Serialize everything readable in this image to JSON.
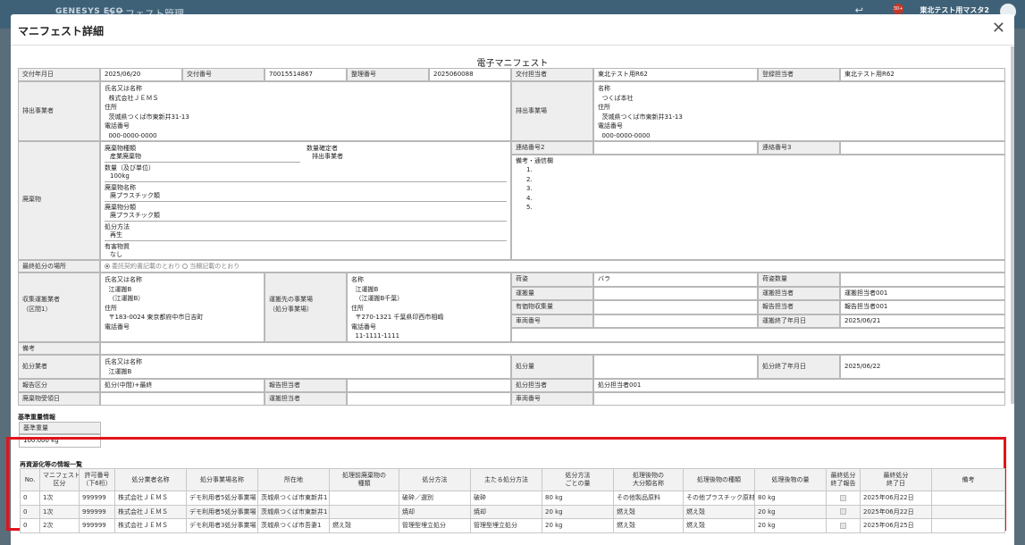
{
  "app": {
    "logo": "GENESYS ECO",
    "title": "マニフェスト管理",
    "user": "東北テスト用マスタ2",
    "badge": "30+"
  },
  "dialog": {
    "title": "マニフェスト詳細",
    "manifest_title": "電子マニフェスト"
  },
  "row1": {
    "l1": "交付年月日",
    "v1": "2025/06/20",
    "l2": "交付番号",
    "v2": "70015514867",
    "l3": "整理番号",
    "v3": "2025060088",
    "l4": "交付担当者",
    "v4": "東北テスト用R62",
    "l5": "登録担当者",
    "v5": "東北テスト用R62"
  },
  "discharger": {
    "label": "排出事業者",
    "text": "氏名又は名称\n  株式会社ＪＥＭＳ\n住所\n  茨城県つくば市東新井31-13\n電話番号\n  000-0000-0000"
  },
  "site": {
    "label": "排出事業場",
    "text": "名称\n  つくば本社\n住所\n  茨城県つくば市東新井31-13\n電話番号\n  000-0000-0000"
  },
  "waste": {
    "label": "廃棄物",
    "type_l": "廃棄物種類",
    "type_v": "産業廃棄物",
    "qty_l": "数量（及び単位）",
    "qty_v": "100kg",
    "name_l": "廃棄物名称",
    "name_v": "廃プラスチック類",
    "cls_l": "廃棄物分類",
    "cls_v": "廃プラスチック類",
    "method_l": "処分方法",
    "method_v": "再生",
    "haz_l": "有害物質",
    "haz_v": "なし",
    "conf_l": "数量確定者",
    "conf_v": "排出事業者"
  },
  "contact": {
    "l2": "連絡番号2",
    "l3": "連絡番号3",
    "remarks_l": "備考・通信欄",
    "remarks": "1.\n2.\n3.\n4.\n5."
  },
  "final": {
    "label": "最終処分の場所",
    "opt1": "委託契約書記載のとおり",
    "opt2": "当欄記載のとおり"
  },
  "transport": {
    "label": "収集運搬業者\n（区間1）",
    "text": "氏名又は名称\n  江運搬B\n  （江運搬B）\n住所\n  〒183-0024 東京都府中市日吉町\n電話番号",
    "dest_l": "運搬先の事業場\n（処分事業場）",
    "dest": "名称\n  江運搬B\n  （江運搬B千葉）\n住所\n  〒270-1321 千葉県印西市相嶋\n電話番号\n  11-1111-1111",
    "pkg_l": "荷姿",
    "pkg_v": "バラ",
    "pkgq_l": "荷姿数量",
    "qty_l": "運搬量",
    "rep_l": "運搬担当者",
    "rep_v": "運搬担当者001",
    "val_l": "有価物収集量",
    "rrep_l": "報告担当者",
    "rrep_v": "報告担当者001",
    "car_l": "車両番号",
    "end_l": "運搬終了年月日",
    "end_v": "2025/06/21"
  },
  "note": {
    "label": "備考"
  },
  "processor": {
    "label": "処分業者",
    "text": "氏名又は名称\n  江運搬B",
    "amt_l": "処分量",
    "end_l": "処分終了年月日",
    "end_v": "2025/06/22",
    "rtype_l": "報告区分",
    "rtype_v": "処分(中間)+最終",
    "rrep_l": "報告担当者",
    "prep_l": "処分担当者",
    "prep_v": "処分担当者001",
    "recv_l": "廃棄物受領日",
    "trep_l": "運搬担当者",
    "car_l": "車両番号"
  },
  "base": {
    "section": "基準重量情報",
    "label": "基準重量",
    "value": "100.000 kg"
  },
  "recycle": {
    "section": "再資源化等の情報一覧",
    "headers": [
      "No.",
      "マニフェスト\n区分",
      "許可番号\n（下6桁）",
      "処分業者名称",
      "処分事業場名称",
      "所在地",
      "処理前廃棄物の\n種類",
      "処分方法",
      "主たる処分方法",
      "処分方法\nごとの量",
      "処理後物の\n大分類名称",
      "処理後物の種類",
      "処理後物の量",
      "最終処分\n終了報告",
      "最終処分\n終了日",
      "備考"
    ],
    "rows": [
      [
        "0",
        "1次",
        "999999",
        "株式会社ＪＥＭＳ",
        "デモ利用者5処分事業場",
        "茨城県つくば市東新井1",
        "",
        "破砕／選別",
        "破砕",
        "80 kg",
        "その他製品原料",
        "その他プラスチック原材料",
        "80 kg",
        "",
        "2025年06月22日",
        ""
      ],
      [
        "0",
        "1次",
        "999999",
        "株式会社ＪＥＭＳ",
        "デモ利用者5処分事業場",
        "茨城県つくば市東新井1",
        "",
        "焼却",
        "焼却",
        "20 kg",
        "燃え殻",
        "燃え殻",
        "20 kg",
        "",
        "2025年06月22日",
        ""
      ],
      [
        "0",
        "2次",
        "999999",
        "株式会社ＪＥＭＳ",
        "デモ利用者3処分事業場",
        "茨城県つくば市吾妻1",
        "燃え殻",
        "管理型埋立処分",
        "管理型埋立処分",
        "20 kg",
        "燃え殻",
        "燃え殻",
        "20 kg",
        "",
        "2025年06月25日",
        ""
      ]
    ]
  }
}
